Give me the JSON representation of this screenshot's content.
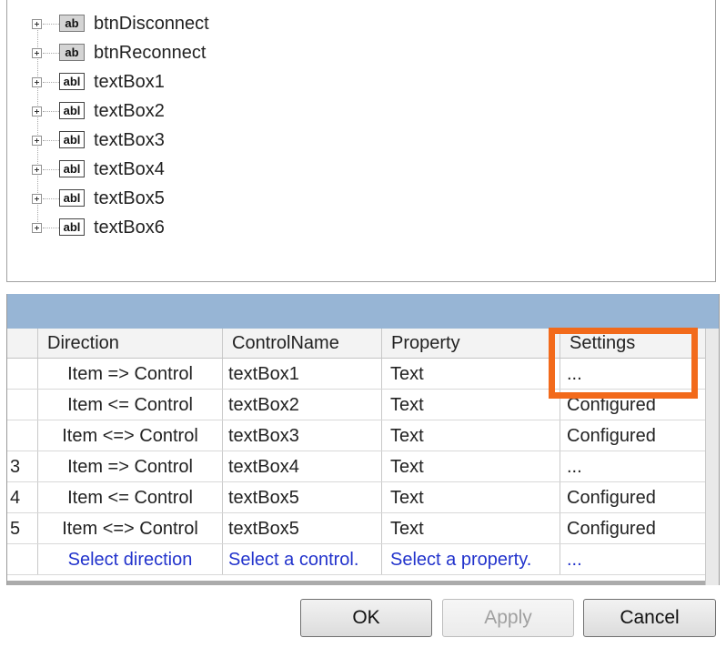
{
  "tree": {
    "items": [
      {
        "icon": "ab",
        "label": "btnDisconnect"
      },
      {
        "icon": "ab",
        "label": "btnReconnect"
      },
      {
        "icon": "abl",
        "label": "textBox1"
      },
      {
        "icon": "abl",
        "label": "textBox2"
      },
      {
        "icon": "abl",
        "label": "textBox3"
      },
      {
        "icon": "abl",
        "label": "textBox4"
      },
      {
        "icon": "abl",
        "label": "textBox5"
      },
      {
        "icon": "abl",
        "label": "textBox6"
      }
    ]
  },
  "grid": {
    "headers": [
      "",
      "Direction",
      "ControlName",
      "Property",
      "Settings"
    ],
    "rows": [
      [
        "",
        "Item => Control",
        "textBox1",
        "Text",
        "..."
      ],
      [
        "",
        "Item <= Control",
        "textBox2",
        "Text",
        "Configured"
      ],
      [
        "",
        "Item <=> Control",
        "textBox3",
        "Text",
        "Configured"
      ],
      [
        "3",
        "Item => Control",
        "textBox4",
        "Text",
        "..."
      ],
      [
        "4",
        "Item <= Control",
        "textBox5",
        "Text",
        "Configured"
      ],
      [
        "5",
        "Item <=> Control",
        "textBox5",
        "Text",
        "Configured"
      ],
      [
        "",
        "Select direction",
        "Select a control.",
        "Select a property.",
        "..."
      ]
    ]
  },
  "buttons": {
    "ok": "OK",
    "apply": "Apply",
    "cancel": "Cancel"
  },
  "colors": {
    "highlight": "#f26a1b",
    "caption_bar": "#97b5d5",
    "link_text": "#2233cc"
  }
}
